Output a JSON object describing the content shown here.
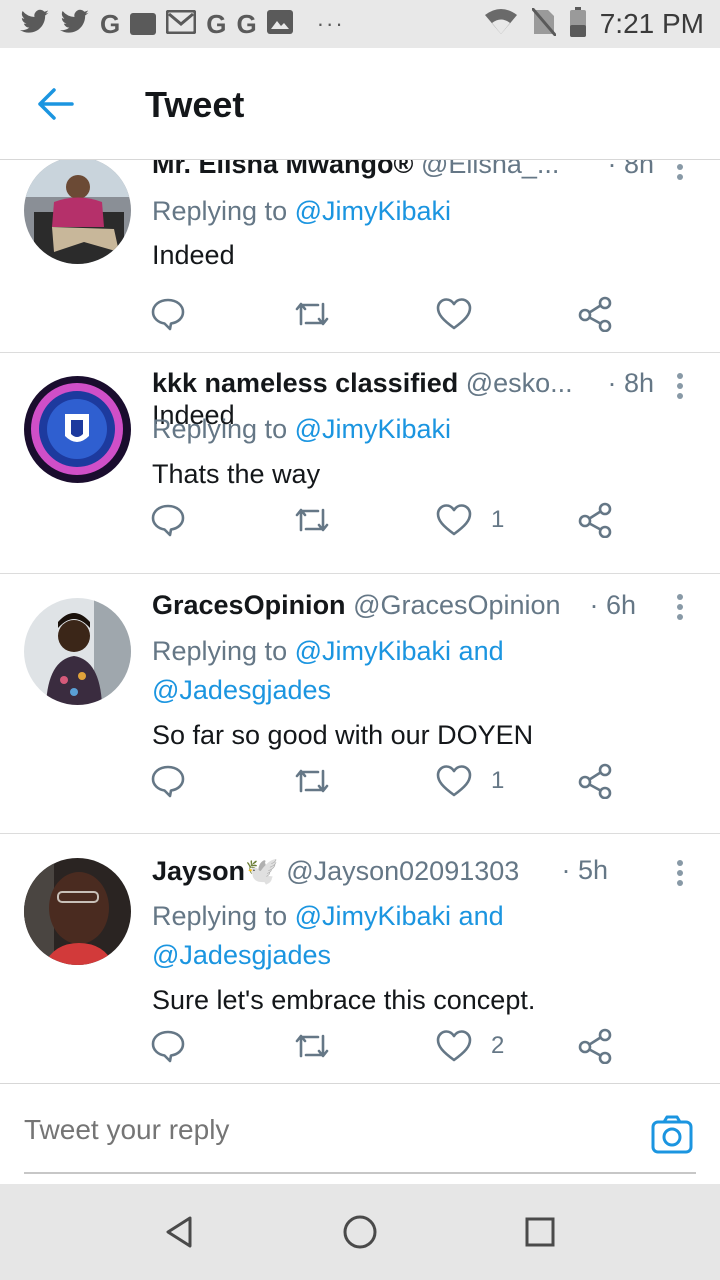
{
  "status_bar": {
    "time": "7:21 PM",
    "left_icons": [
      "twitter-icon",
      "twitter-icon",
      "google-icon",
      "outlook-icon",
      "gmail-icon",
      "google-icon",
      "google-icon",
      "image-icon"
    ],
    "overflow": "···"
  },
  "header": {
    "title": "Tweet"
  },
  "tweets": [
    {
      "name": "Mr. Elisha Mwango®",
      "handle": "@Elisha_...",
      "time": "· 8h",
      "replying_prefix": "Replying to",
      "mentions": "@JimyKibaki",
      "mentions_line2": "",
      "text": "Indeed",
      "likes": ""
    },
    {
      "name": "kkk nameless classified",
      "handle": "@esko...",
      "time": "· 8h",
      "replying_prefix": "Replying to",
      "mentions": "@JimyKibaki",
      "mentions_line2": "",
      "text": "Thats the way",
      "likes": "1"
    },
    {
      "name": "GracesOpinion",
      "handle": "@GracesOpinion",
      "time": "· 6h",
      "replying_prefix": "Replying to",
      "mentions": "@JimyKibaki and",
      "mentions_line2": "@Jadesgjades",
      "text": "So far so good with our DOYEN",
      "likes": "1"
    },
    {
      "name": "Jayson🕊️",
      "handle": "@Jayson02091303",
      "time": "· 5h",
      "replying_prefix": "Replying to",
      "mentions": "@JimyKibaki and",
      "mentions_line2": "@Jadesgjades",
      "text": "Sure let's embrace this concept.",
      "likes": "2"
    }
  ],
  "compose": {
    "placeholder": "Tweet your reply"
  },
  "colors": {
    "accent": "#1b95e0",
    "text": "#14171a",
    "muted": "#657786"
  }
}
